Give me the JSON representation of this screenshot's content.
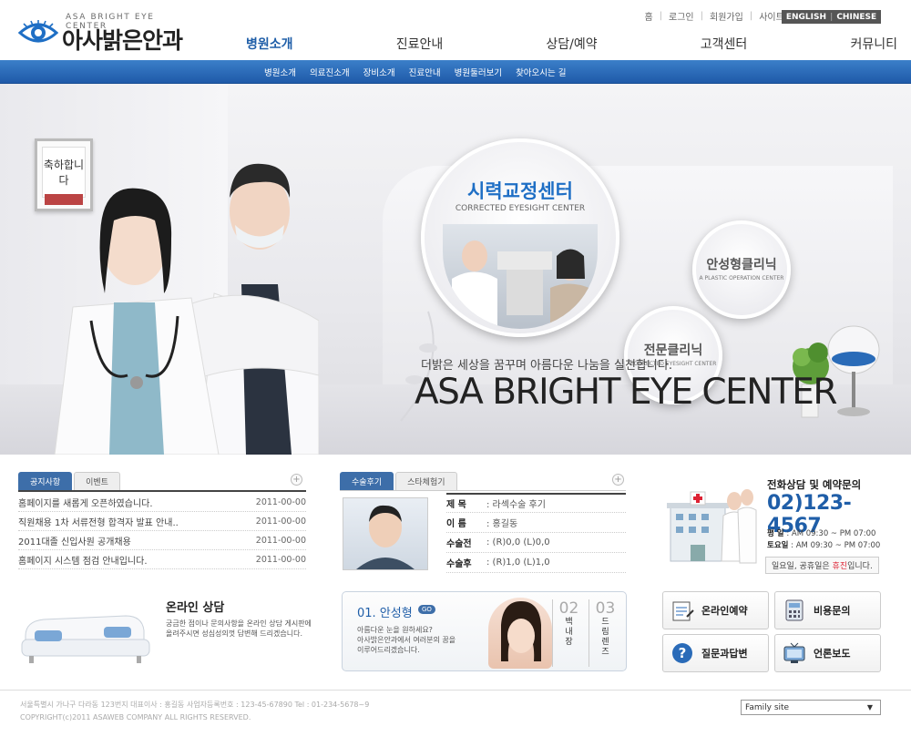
{
  "logo": {
    "sub": "ASA BRIGHT EYE CENTER",
    "name": "아사밝은안과"
  },
  "util": {
    "items": [
      "홈",
      "로그인",
      "회원가입",
      "사이트맵"
    ]
  },
  "lang": {
    "english": "ENGLISH",
    "chinese": "CHINESE"
  },
  "gnb": [
    "병원소개",
    "진료안내",
    "상담/예약",
    "고객센터",
    "커뮤니티"
  ],
  "subnav": [
    "병원소개",
    "의료진소개",
    "장비소개",
    "진료안내",
    "병원둘러보기",
    "찾아오시는 길"
  ],
  "hero": {
    "main_circle": {
      "title": "시력교정센터",
      "sub": "CORRECTED EYESIGHT CENTER"
    },
    "circle2": {
      "title": "안성형클리닉",
      "sub": "A PLASTIC OPERATION CENTER"
    },
    "circle3": {
      "title": "전문클리닉",
      "sub": "CORRECTED EYESIGHT CENTER"
    },
    "slogan": "더밝은 세상을 꿈꾸며 아름다운 나눔을 실천합니다.",
    "brand": "ASA BRIGHT EYE CENTER",
    "frame_text": "축하합니다"
  },
  "notice": {
    "tabs": [
      "공지사항",
      "이벤트"
    ],
    "rows": [
      {
        "title": "홈페이지를 새롭게 오픈하였습니다.",
        "date": "2011-00-00"
      },
      {
        "title": "직원채용 1차 서류전형 합격자 발표 안내..",
        "date": "2011-00-00"
      },
      {
        "title": "2011대졸 신입사원 공개채용",
        "date": "2011-00-00"
      },
      {
        "title": "홈페이지 시스템 점검 안내입니다.",
        "date": "2011-00-00"
      }
    ]
  },
  "review": {
    "tabs": [
      "수술후기",
      "스타체험기"
    ],
    "rows": [
      {
        "k": "제 목",
        "v": ": 라섹수술 후기"
      },
      {
        "k": "이 름",
        "v": ": 홍길동"
      },
      {
        "k": "수술전",
        "v": ": (R)0,0  (L)0,0"
      },
      {
        "k": "수술후",
        "v": ": (R)1,0  (L)1,0"
      }
    ]
  },
  "contact": {
    "title": "전화상담 및 예약문의",
    "phone": "02)123-4567",
    "hours1_label": "평  일",
    "hours1": ": AM 09:30 ~ PM 07:00",
    "hours2_label": "토요일",
    "hours2": ": AM 09:30 ~ PM 07:00",
    "note_pre": "일요일, 공휴일은 ",
    "note_red": "휴진",
    "note_post": "입니다."
  },
  "online": {
    "title": "온라인 상담",
    "desc": "궁금한 점이나 문의사항을 온라인 상담 게시판에 올려주시면 성심성의껏 답변해 드리겠습니다."
  },
  "promo": {
    "title": "01. 안성형",
    "go": "GO",
    "desc": [
      "아름다운 눈을 원하세요?",
      "아사밝은안과에서 여러분의 꿈을",
      "이루어드리겠습니다."
    ],
    "v1_num": "02",
    "v1_text": [
      "백",
      "내",
      "장"
    ],
    "v2_num": "03",
    "v2_text": [
      "드",
      "림",
      "렌",
      "즈"
    ]
  },
  "quick": [
    "온라인예약",
    "비용문의",
    "질문과답변",
    "언론보도"
  ],
  "footer": {
    "line1": "서울특별시 가나구 다라동 123번지    대표이사 : 홍길동    사업자등록번호 : 123-45-67890    Tel : 01-234-5678~9",
    "line2": "COPYRIGHT(c)2011  ASAWEB COMPANY ALL RIGHTS RESERVED."
  },
  "family_site": "Family site",
  "colors": {
    "brand_blue": "#1f5ea8",
    "nav_bar": "#2a6bb8",
    "accent_red": "#d23"
  }
}
